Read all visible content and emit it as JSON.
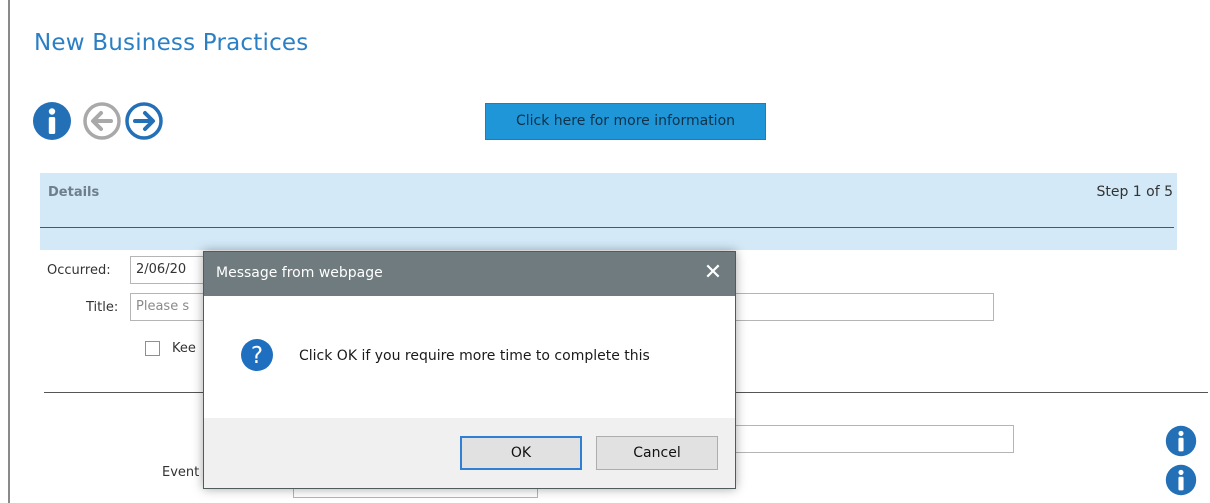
{
  "page": {
    "title": "New Business Practices",
    "more_info_button": "Click here for more information"
  },
  "nav": {
    "info_icon": "info-circle-icon",
    "back_icon": "arrow-left-circle-icon",
    "forward_icon": "arrow-right-circle-icon",
    "back_enabled": false,
    "forward_enabled": true
  },
  "details": {
    "label": "Details",
    "step": "Step 1 of 5"
  },
  "form": {
    "occurred_label": "Occurred:",
    "occurred_value": "2/06/20",
    "title_label": "Title:",
    "title_placeholder": "Please s",
    "keep_label": "Kee",
    "event_label": "Event"
  },
  "dialog": {
    "title": "Message from webpage",
    "close_glyph": "✕",
    "message": "Click OK if you require more time to complete this",
    "icon": "question-icon",
    "ok_label": "OK",
    "cancel_label": "Cancel"
  },
  "colors": {
    "accent": "#2a7fc5",
    "button_blue": "#1e96d8",
    "details_band": "#d3e9f7",
    "dialog_titlebar": "#6f7b7e"
  }
}
